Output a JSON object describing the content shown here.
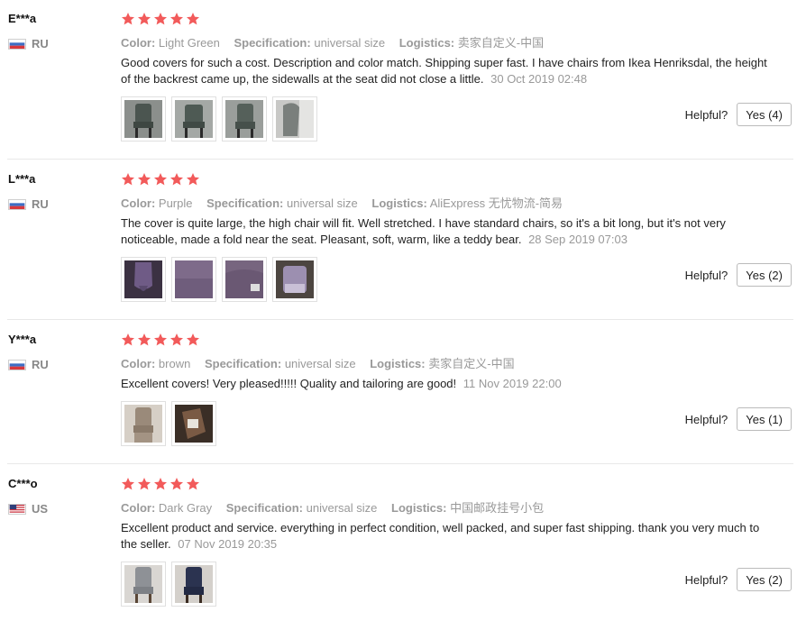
{
  "labels": {
    "color": "Color:",
    "specification": "Specification:",
    "logistics": "Logistics:",
    "helpful": "Helpful?"
  },
  "colors": {
    "star": "#f25a5a",
    "meta": "#999999",
    "text": "#222222"
  },
  "reviews": [
    {
      "user": "E***a",
      "country": "RU",
      "rating": 5,
      "color": "Light Green",
      "specification": "universal size",
      "logistics": "卖家自定义-中国",
      "text": "Good covers for such a cost. Description and color match. Shipping super fast. I have chairs from Ikea Henriksdal, the height of the backrest came up, the sidewalls at the seat did not close a little.",
      "date": "30 Oct 2019 02:48",
      "helpful_button": "Yes (4)",
      "photos": [
        "green-chair-photo",
        "green-chair-photo",
        "green-chair-photo",
        "green-chair-photo"
      ]
    },
    {
      "user": "L***a",
      "country": "RU",
      "rating": 5,
      "color": "Purple",
      "specification": "universal size",
      "logistics": "AliExpress 无忧物流-简易",
      "text": "The cover is quite large, the high chair will fit. Well stretched. I have standard chairs, so it's a bit long, but it's not very noticeable, made a fold near the seat. Pleasant, soft, warm, like a teddy bear.",
      "date": "28 Sep 2019 07:03",
      "helpful_button": "Yes (2)",
      "photos": [
        "purple-chair-photo",
        "purple-fabric-photo",
        "purple-fabric-photo",
        "purple-chair-photo"
      ]
    },
    {
      "user": "Y***a",
      "country": "RU",
      "rating": 5,
      "color": "brown",
      "specification": "universal size",
      "logistics": "卖家自定义-中国",
      "text": "Excellent covers! Very pleased!!!!! Quality and tailoring are good!",
      "date": "11 Nov 2019 22:00",
      "helpful_button": "Yes (1)",
      "photos": [
        "brown-chair-photo",
        "brown-package-photo"
      ]
    },
    {
      "user": "C***o",
      "country": "US",
      "rating": 5,
      "color": "Dark Gray",
      "specification": "universal size",
      "logistics": "中国邮政挂号小包",
      "text": "Excellent product and service. everything in perfect condition, well packed, and super fast shipping. thank you very much to the seller.",
      "date": "07 Nov 2019 20:35",
      "helpful_button": "Yes (2)",
      "photos": [
        "gray-chair-photo",
        "navy-chair-photo"
      ]
    }
  ]
}
